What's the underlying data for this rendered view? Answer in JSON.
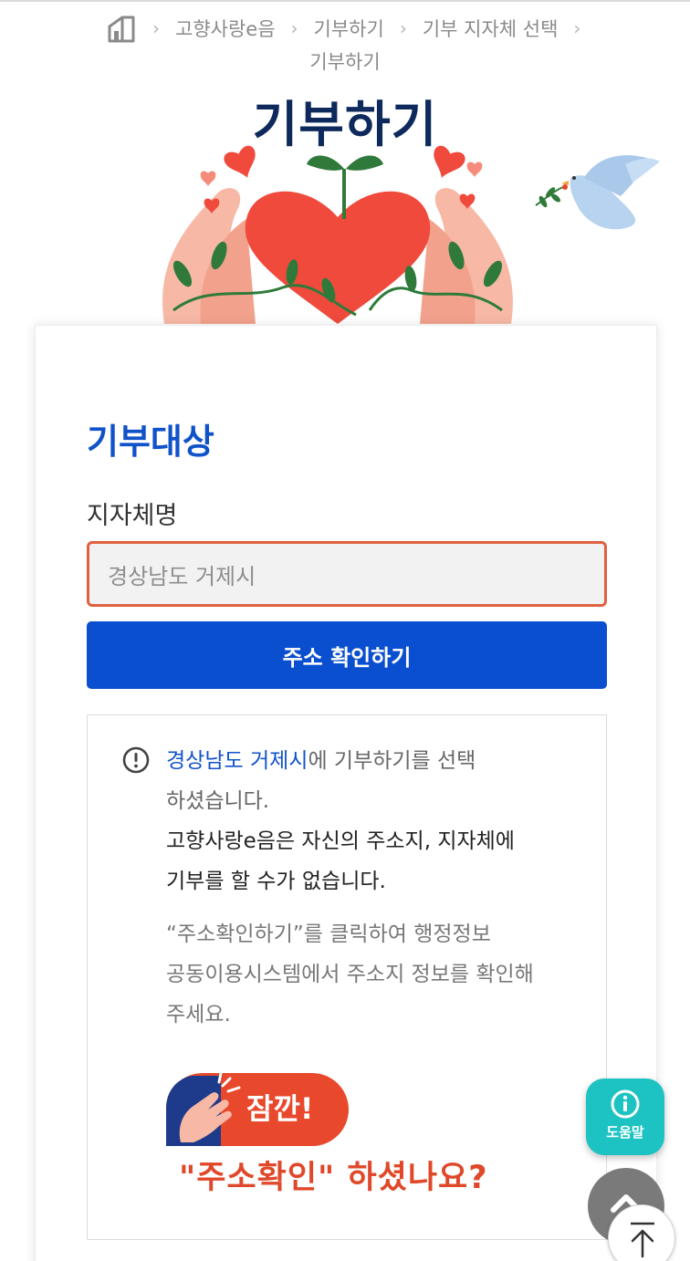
{
  "breadcrumb": {
    "home_icon": "home-icon",
    "items": [
      "고향사랑e음",
      "기부하기",
      "기부 지자체 선택",
      "기부하기"
    ]
  },
  "page": {
    "title": "기부하기"
  },
  "form": {
    "section_title": "기부대상",
    "field_label": "지자체명",
    "field_value": "경상남도 거제시",
    "confirm_button": "주소 확인하기"
  },
  "notice": {
    "icon": "exclamation-circle-icon",
    "highlight": "경상남도 거제시",
    "line1_rest": "에 기부하기를 선택",
    "line2": "하셨습니다.",
    "line3": "고향사랑e음은 자신의 주소지, 지자체에",
    "line4": "기부를 할 수가 없습니다.",
    "gray1": "“주소확인하기”를 클릭하여 행정정보",
    "gray2": "공동이용시스템에서 주소지 정보를 확인해",
    "gray3": "주세요.",
    "banner_text": "잠깐!",
    "question": "\"주소확인\" 하셨나요?"
  },
  "fab": {
    "help_label": "도움말",
    "help_icon": "info-icon",
    "up_icon": "chevron-up-icon",
    "top_icon": "arrow-up-icon"
  },
  "colors": {
    "title": "#0e2a5c",
    "accent_blue": "#0a4fd0",
    "field_border": "#e0613f",
    "help_fab": "#1cc3c2",
    "question": "#e0482a"
  }
}
